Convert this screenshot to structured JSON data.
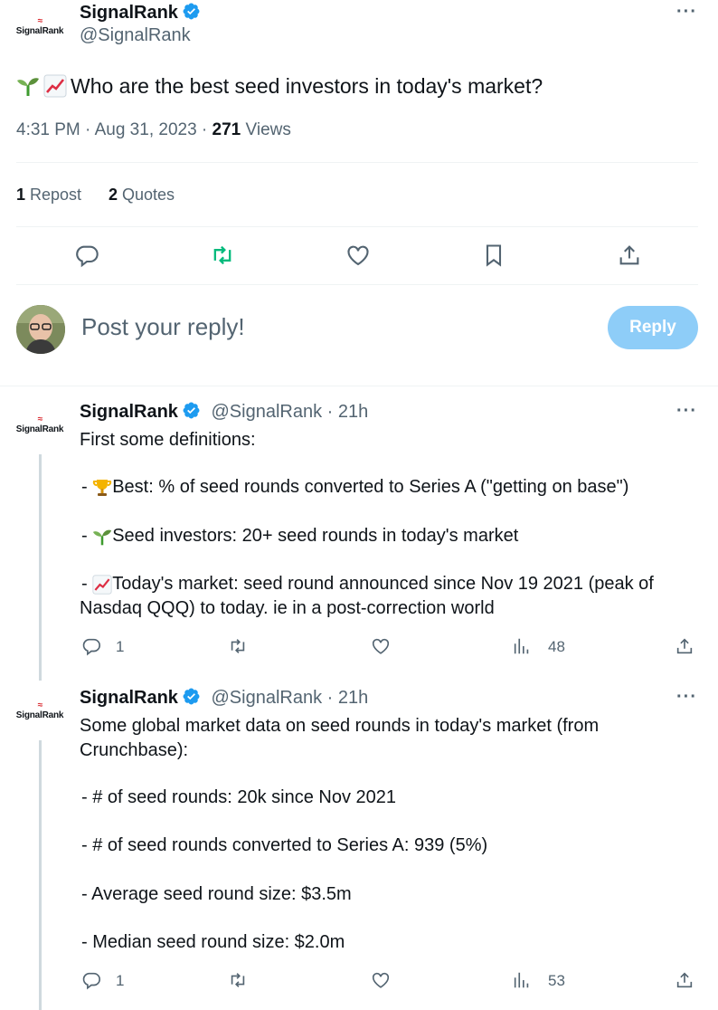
{
  "tweet": {
    "logo_mark": "≈",
    "logo_text": "SignalRank",
    "name": "SignalRank",
    "handle": "@SignalRank",
    "more": "···",
    "text": "Who are the best seed investors in today's market?",
    "time": "4:31 PM · Aug 31, 2023 · ",
    "views_count": "271",
    "views_label": " Views",
    "reposts_count": "1",
    "reposts_label": " Repost",
    "quotes_count": "2",
    "quotes_label": " Quotes"
  },
  "reply_box": {
    "placeholder": "Post your reply!",
    "button": "Reply"
  },
  "replies": [
    {
      "name": "SignalRank",
      "handle": "@SignalRank",
      "dot": " · ",
      "time": "21h",
      "more": "···",
      "line1": "First some definitions:",
      "line2": "Best: % of seed rounds converted to Series A (\"getting on base\")",
      "line3": "Seed investors: 20+ seed rounds in today's market",
      "line4a": "Today's market: seed round announced since Nov 19 2021 (peak of",
      "line4b": "Nasdaq QQQ) to today. ie in a post-correction world",
      "dash": "- ",
      "replies": "1",
      "views": "48"
    },
    {
      "name": "SignalRank",
      "handle": "@SignalRank",
      "dot": " · ",
      "time": "21h",
      "more": "···",
      "line1a": "Some global market data on seed rounds in today's market (from",
      "line1b": "Crunchbase):",
      "line2": "- # of seed rounds: 20k since Nov 2021",
      "line3": "- # of seed rounds converted to Series A: 939 (5%)",
      "line4": "- Average seed round size: $3.5m",
      "line5": "- Median seed round size: $2.0m",
      "replies": "1",
      "views": "53"
    }
  ],
  "colors": {
    "accent": "#1d9bf0",
    "repost_green": "#00ba7c",
    "muted": "#536471",
    "brand_red": "#d9262c"
  }
}
